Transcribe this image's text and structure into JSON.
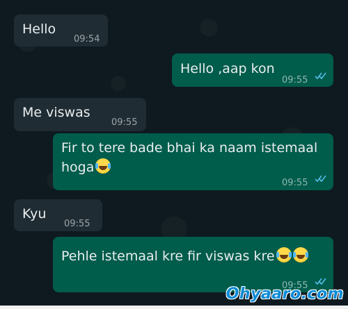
{
  "conversation": {
    "messages": [
      {
        "direction": "incoming",
        "text": "Hello",
        "time": "09:54"
      },
      {
        "direction": "outgoing",
        "text": "Hello ,aap kon",
        "time": "09:55",
        "status": "read"
      },
      {
        "direction": "incoming",
        "text": "Me viswas",
        "time": "09:55"
      },
      {
        "direction": "outgoing",
        "text_line1": "Fir to tere bade bhai ka naam istemaal",
        "text_line2": "hoga",
        "emoji": "face-with-tears-of-joy",
        "time": "09:55",
        "status": "read"
      },
      {
        "direction": "incoming",
        "text": "Kyu",
        "time": "09:55"
      },
      {
        "direction": "outgoing",
        "text": "Pehle istemaal kre fir viswas kre",
        "emoji": "face-with-tears-of-joy",
        "emoji_count": 2,
        "time": "09:55",
        "status": "read"
      }
    ]
  },
  "watermark": {
    "text": "Ohyaaro.com"
  },
  "colors": {
    "background": "#0e1a1f",
    "incoming_bubble": "#1f2c33",
    "outgoing_bubble": "#005c4b",
    "read_ticks": "#53bdeb"
  }
}
